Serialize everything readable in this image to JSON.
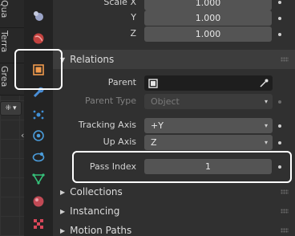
{
  "left_tabs": [
    "Qua",
    "Terra",
    "Grea"
  ],
  "mode_select": "⁜",
  "transform": {
    "scale_label": "Scale X",
    "scale_x": "1.000",
    "y_label": "Y",
    "y": "1.000",
    "z_label": "Z",
    "z": "1.000"
  },
  "relations": {
    "title": "Relations",
    "parent_label": "Parent",
    "parent_type_label": "Parent Type",
    "parent_type_value": "Object",
    "tracking_axis_label": "Tracking Axis",
    "tracking_axis_value": "+Y",
    "up_axis_label": "Up Axis",
    "up_axis_value": "Z",
    "pass_index_label": "Pass Index",
    "pass_index_value": "1"
  },
  "sections": {
    "collections": "Collections",
    "instancing": "Instancing",
    "motion_paths": "Motion Paths"
  },
  "property_tabs": [
    "tool-icon",
    "render-icon",
    "world-icon",
    "object-icon",
    "modifier-icon",
    "particles-icon",
    "physics-icon",
    "constraints-icon",
    "data-icon",
    "material-icon",
    "texture-icon"
  ]
}
